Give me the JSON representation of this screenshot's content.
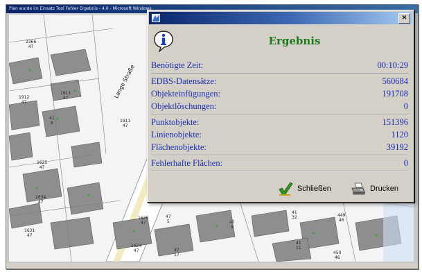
{
  "background": {
    "window_title": "Plan wurde im Einsatz Tool Fehler Ergebnis - 4.0 - Microsoft Windows",
    "street_name": "Lange Straße",
    "parcel_labels": [
      {
        "top": "2366",
        "bottom": "47"
      },
      {
        "top": "1912",
        "bottom": "47"
      },
      {
        "top": "1911",
        "bottom": "47"
      },
      {
        "top": "41",
        "bottom": "9"
      },
      {
        "top": "1911",
        "bottom": "47"
      },
      {
        "top": "1625",
        "bottom": "47"
      },
      {
        "top": "1634",
        "bottom": "47"
      },
      {
        "top": "1631",
        "bottom": "47"
      },
      {
        "top": "1624",
        "bottom": "47"
      },
      {
        "top": "1625",
        "bottom": "47"
      },
      {
        "top": "47",
        "bottom": "5"
      },
      {
        "top": "47",
        "bottom": "17"
      },
      {
        "top": "47",
        "bottom": "9"
      },
      {
        "top": "41",
        "bottom": "11"
      },
      {
        "top": "449",
        "bottom": "46"
      },
      {
        "top": "450",
        "bottom": "46"
      },
      {
        "top": "41",
        "bottom": "32"
      }
    ]
  },
  "dialog": {
    "close_glyph": "×",
    "heading": "Ergebnis",
    "groups": [
      [
        {
          "label": "Benötigte Zeit:",
          "value": "00:10:29"
        }
      ],
      [
        {
          "label": "EDBS-Datensätze:",
          "value": "560684"
        },
        {
          "label": "Objekteinfügungen:",
          "value": "191708"
        },
        {
          "label": "Objektlöschungen:",
          "value": "0"
        }
      ],
      [
        {
          "label": "Punktobjekte:",
          "value": "151396"
        },
        {
          "label": "Linienobjekte:",
          "value": "1120"
        },
        {
          "label": "Flächenobjekte:",
          "value": "39192"
        }
      ],
      [
        {
          "label": "Fehlerhafte Flächen:",
          "value": "0"
        }
      ]
    ],
    "buttons": {
      "close_label": "Schließen",
      "print_label": "Drucken"
    }
  },
  "colors": {
    "result_text": "#1a2fb0",
    "heading": "#1d7a1d",
    "title_bar": "#0a246a"
  },
  "icons": {
    "info": "info-icon",
    "close_button": "checkmark-icon",
    "print_button": "printer-icon"
  }
}
